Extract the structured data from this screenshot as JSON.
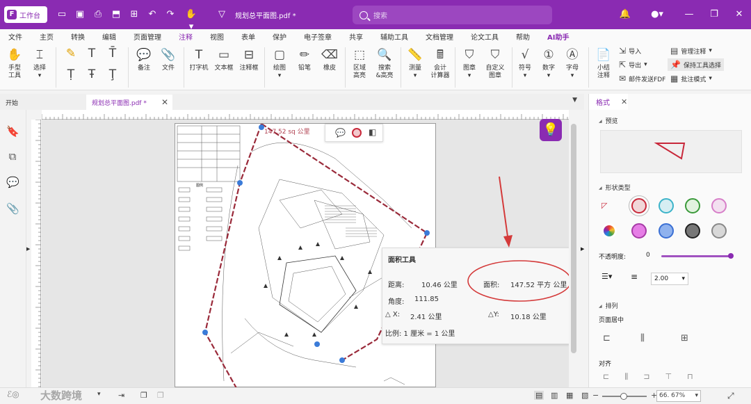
{
  "titlebar": {
    "workbench": "工作台",
    "doc_title": "规划总平面图.pdf *",
    "search_placeholder": "搜索"
  },
  "menu": [
    "文件",
    "主页",
    "转换",
    "编辑",
    "页面管理",
    "注释",
    "视图",
    "表单",
    "保护",
    "电子签章",
    "共享",
    "辅助工具",
    "文档管理",
    "论文工具",
    "帮助",
    "AI助手"
  ],
  "menu_active": "注释",
  "ribbon": {
    "hand": "手型\n工具",
    "select": "选择",
    "note": "备注",
    "file": "文件",
    "typewriter": "打字机",
    "textbox": "文本框",
    "callout": "注释框",
    "draw": "绘图",
    "pencil": "铅笔",
    "eraser": "橡皮",
    "area_highlight": "区域\n高亮",
    "search_highlight": "搜索\n&高亮",
    "measure": "测量",
    "calculator": "会计\n计算器",
    "stamp": "图章",
    "custom_stamp": "自定义\n图章",
    "symbol": "符号",
    "number": "数字",
    "letter": "字母",
    "summary": "小结\n注释",
    "import": "导入",
    "export": "导出",
    "send_email": "邮件发送FDF",
    "manage": "管理注释",
    "keep_tool": "保持工具选择",
    "batch_mode": "批注模式"
  },
  "tabs": {
    "start": "开始",
    "plan": "规划总平面图.pdf *"
  },
  "canvas": {
    "measure_label": "147.52 sq 公里"
  },
  "area_tool": {
    "title": "面积工具",
    "distance_label": "距离:",
    "distance_value": "10.46 公里",
    "area_label": "面积:",
    "area_value": "147.52 平方 公里",
    "angle_label": "角度:",
    "angle_value": "111.85",
    "dx_label": "X:",
    "dx_value": "2.41 公里",
    "dy_label": "Y:",
    "dy_value": "10.18 公里",
    "scale": "比例: 1 厘米 = 1 公里"
  },
  "right_panel": {
    "tab": "格式",
    "preview": "预览",
    "shape_type": "形状类型",
    "opacity_label": "不透明度:",
    "opacity_value": "0",
    "line_width": "2.00",
    "arrange": "排列",
    "page_center": "页面居中",
    "align": "对齐"
  },
  "colors": {
    "accent": "#8a2bb2",
    "shape_stroke": "#c8283a",
    "highlight": "#d43a3a"
  },
  "statusbar": {
    "zoom": "66. 67%",
    "watermark": "大数跨境"
  }
}
